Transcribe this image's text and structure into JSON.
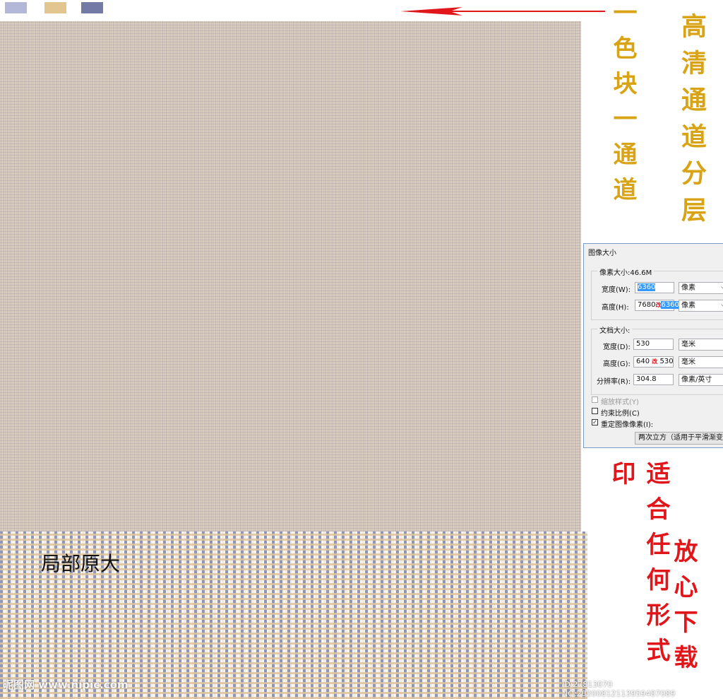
{
  "colors": {
    "chip_1": "#b4b8d8",
    "chip_2": "#e3c68f",
    "chip_3": "#737aa6",
    "fabric_base": "#d3c7b9",
    "arrow": "#e0161b",
    "gold_text": "#d9a316",
    "red_text": "#e0161b"
  },
  "vertical_text": {
    "gold_left": "一色块一通道",
    "gold_right": "高清通道分层",
    "red_left": "适合任何形式印",
    "red_right": "放心下载"
  },
  "detail_label": "局部原大",
  "dialog": {
    "title": "图像大小",
    "pixel_size_label": "像素大小:46.6M",
    "width_label": "宽度(W):",
    "width_value": "6360",
    "height_label": "高度(H):",
    "height_value_old": "7680",
    "height_mark": "改",
    "height_value_new": "6360",
    "pixel_unit": "像素",
    "doc_size_label": "文档大小:",
    "doc_width_label": "宽度(D):",
    "doc_width_value": "530",
    "doc_height_label": "高度(G):",
    "doc_height_old": "640",
    "doc_height_mark": "改",
    "doc_height_new": "530",
    "mm_unit": "毫米",
    "resolution_label": "分辨率(R):",
    "resolution_value": "304.8",
    "resolution_unit": "像素/英寸",
    "scale_styles": "缩放样式(Y)",
    "constrain": "约束比例(C)",
    "resample": "重定图像像素(I):",
    "resample_method": "两次立方（适用于平滑渐变"
  },
  "watermark": {
    "left": "昵图网 www.nipic.com",
    "right": "ID:27813070 NO:20200812113959487089"
  }
}
